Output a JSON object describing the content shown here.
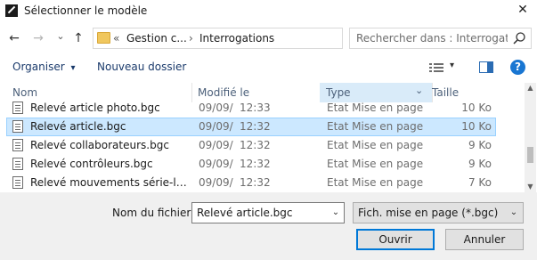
{
  "window": {
    "title": "Sélectionner le modèle",
    "close_glyph": "✕"
  },
  "nav": {
    "back_glyph": "←",
    "forward_glyph": "→",
    "recent_glyph": "⌄",
    "up_glyph": "↑",
    "breadcrumb_prefix": "«",
    "breadcrumbs": [
      "Gestion c...",
      "Interrogations"
    ],
    "separator": "›",
    "dropdown_glyph": "⌄",
    "refresh_glyph": "↻"
  },
  "search": {
    "placeholder": "Rechercher dans : Interrogations"
  },
  "commandbar": {
    "organize_label": "Organiser",
    "organize_arrow": "▾",
    "new_folder_label": "Nouveau dossier",
    "view_arrow": "▾",
    "help_glyph": "?"
  },
  "columns": {
    "name": "Nom",
    "modified": "Modifié le",
    "type": "Type",
    "size": "Taille",
    "sort_glyph": "^",
    "type_filter_glyph": "⌄"
  },
  "files": [
    {
      "name": "Relevé article photo.bgc",
      "date": "09/09/",
      "time": "12:33",
      "type": "Etat Mise en page",
      "size": "10 Ko",
      "selected": false
    },
    {
      "name": "Relevé article.bgc",
      "date": "09/09/",
      "time": "12:32",
      "type": "Etat Mise en page",
      "size": "10 Ko",
      "selected": true
    },
    {
      "name": "Relevé collaborateurs.bgc",
      "date": "09/09/",
      "time": "12:32",
      "type": "Etat Mise en page",
      "size": "9 Ko",
      "selected": false
    },
    {
      "name": "Relevé contrôleurs.bgc",
      "date": "09/09/",
      "time": "12:32",
      "type": "Etat Mise en page",
      "size": "9 Ko",
      "selected": false
    },
    {
      "name": "Relevé mouvements série-lot.b...",
      "date": "09/09/",
      "time": "12:32",
      "type": "Etat Mise en page",
      "size": "7 Ko",
      "selected": false
    }
  ],
  "scrollbar": {
    "up_glyph": "▲",
    "down_glyph": "▼"
  },
  "footer": {
    "filename_label": "Nom du fichier :",
    "filename_value": "Relevé article.bgc",
    "filename_arrow": "⌄",
    "filter_value": "Fich. mise en page (*.bgc)",
    "filter_arrow": "⌄",
    "open_label": "Ouvrir",
    "cancel_label": "Annuler"
  },
  "colors": {
    "accent": "#0078d7",
    "selection": "#cce8ff",
    "help_icon": "#1976d2"
  }
}
